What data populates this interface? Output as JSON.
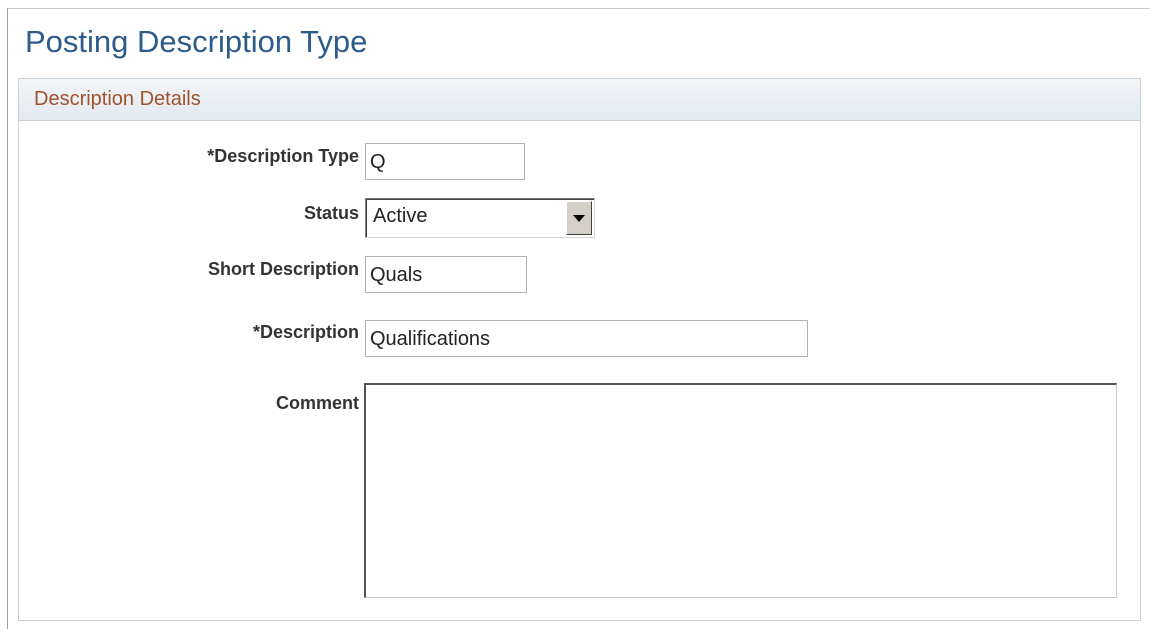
{
  "page": {
    "title": "Posting Description Type"
  },
  "group": {
    "title": "Description Details"
  },
  "fields": {
    "description_type": {
      "label": "*Description Type",
      "value": "Q"
    },
    "status": {
      "label": "Status",
      "value": "Active"
    },
    "short_description": {
      "label": "Short Description",
      "value": "Quals"
    },
    "description": {
      "label": "*Description",
      "value": "Qualifications"
    },
    "comment": {
      "label": "Comment",
      "value": ""
    }
  },
  "colors": {
    "title": "#2d5b8a",
    "group_title": "#a0522d",
    "label": "#333333"
  },
  "icons": {
    "dropdown": "chevron-down-icon"
  }
}
